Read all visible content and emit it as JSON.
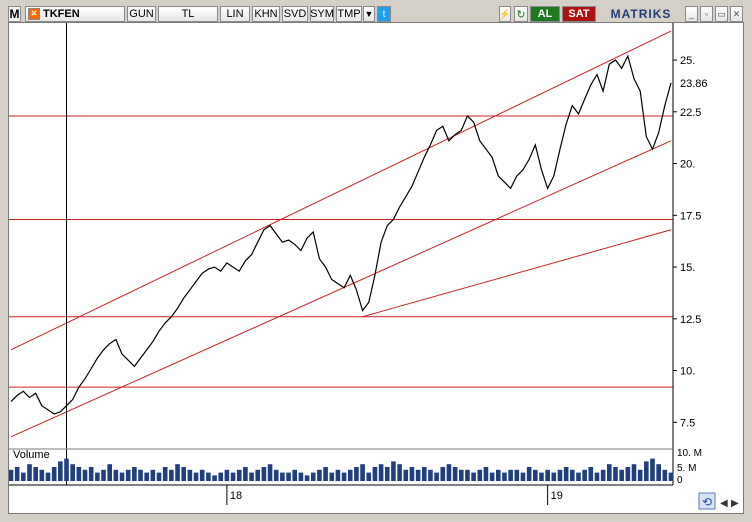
{
  "toolbar": {
    "logo": "M",
    "symbol": "TKFEN",
    "period": "GUN",
    "currency": "TL",
    "scale": "LIN",
    "buttons": [
      "KHN",
      "SVD",
      "SYM",
      "TMP"
    ],
    "buy_label": "AL",
    "sell_label": "SAT",
    "brand": "MATRIKS"
  },
  "icons": {
    "logo": "m-logo-icon",
    "close_small": "close-icon",
    "dropdown": "chevron-down-icon",
    "twitter": "twitter-icon",
    "refresh": "refresh-icon",
    "minimize": "minimize-icon",
    "restore": "restore-icon",
    "close": "close-icon",
    "sync": "sync-icon",
    "scroll_left": "arrow-left-icon",
    "scroll_right": "arrow-right-icon"
  },
  "colors": {
    "price_line": "#000000",
    "trend_lines": "#cc2222",
    "volume_bars": "#1f3f7f",
    "buy": "#1e7a1e",
    "sell": "#b01212"
  },
  "chart_data": {
    "type": "line",
    "series": [
      {
        "values": [
          8.5,
          8.8,
          9.0,
          8.7,
          8.9,
          8.3,
          8.1,
          7.9,
          8.0,
          8.3,
          8.6,
          9.2,
          9.6,
          10.1,
          10.6,
          11.0,
          11.3,
          11.5,
          10.8,
          10.5,
          10.2,
          10.6,
          11.0,
          11.4,
          11.9,
          12.3,
          12.6,
          13.0,
          13.5,
          13.9,
          14.3,
          14.7,
          14.9,
          15.0,
          14.8,
          15.2,
          15.0,
          14.8,
          15.3,
          15.6,
          16.2,
          16.8,
          17.0,
          16.6,
          16.2,
          16.3,
          16.1,
          15.8,
          16.4,
          16.7,
          15.4,
          15.0,
          14.4,
          14.2,
          14.0,
          14.6,
          13.9,
          12.9,
          13.3,
          14.6,
          16.2,
          17.0,
          17.3,
          17.9,
          18.4,
          18.9,
          19.6,
          20.3,
          20.9,
          21.6,
          21.8,
          21.1,
          21.4,
          21.6,
          22.3,
          22.0,
          21.1,
          20.7,
          20.3,
          19.4,
          19.1,
          18.8,
          19.4,
          19.7,
          20.2,
          20.9,
          19.7,
          18.8,
          19.4,
          20.7,
          21.9,
          22.8,
          22.4,
          23.1,
          23.8,
          24.3,
          23.5,
          24.8,
          25.0,
          24.6,
          25.2,
          24.1,
          23.5,
          21.3,
          20.7,
          21.5,
          22.8,
          23.9
        ]
      }
    ],
    "volume": {
      "label": "Volume",
      "values": [
        4,
        5,
        3,
        6,
        5,
        4,
        3,
        5,
        7,
        8,
        6,
        5,
        4,
        5,
        3,
        4,
        6,
        4,
        3,
        4,
        5,
        4,
        3,
        4,
        3,
        5,
        4,
        6,
        5,
        4,
        3,
        4,
        3,
        2,
        3,
        4,
        3,
        4,
        5,
        3,
        4,
        5,
        6,
        4,
        3,
        3,
        4,
        3,
        2,
        3,
        4,
        5,
        3,
        4,
        3,
        4,
        5,
        6,
        3,
        5,
        6,
        5,
        7,
        6,
        4,
        5,
        4,
        5,
        4,
        3,
        5,
        6,
        5,
        4,
        4,
        3,
        4,
        5,
        3,
        4,
        3,
        4,
        4,
        3,
        5,
        4,
        3,
        4,
        3,
        4,
        5,
        4,
        3,
        4,
        5,
        3,
        4,
        6,
        5,
        4,
        5,
        6,
        4,
        7,
        8,
        6,
        4,
        3
      ],
      "yticks": [
        "10. M",
        "5. M",
        "0"
      ]
    },
    "yticks": [
      "25.",
      "22.5",
      "20.",
      "17.5",
      "15.",
      "12.5",
      "10.",
      "7.5"
    ],
    "last_value_label": "23.86",
    "xticks": [
      "18",
      "19"
    ],
    "ylim": [
      6.5,
      26.5
    ],
    "horizontal_lines": [
      22.3,
      17.3,
      12.6,
      9.2
    ],
    "trend_lines": [
      {
        "from": [
          0,
          11.0
        ],
        "to": [
          107,
          26.4
        ]
      },
      {
        "from": [
          0,
          6.8
        ],
        "to": [
          107,
          21.1
        ]
      },
      {
        "from": [
          57,
          12.6
        ],
        "to": [
          107,
          16.8
        ]
      }
    ],
    "xlim": [
      0,
      107
    ],
    "xtick_positions": [
      35,
      87
    ],
    "cursor_x": 9
  }
}
